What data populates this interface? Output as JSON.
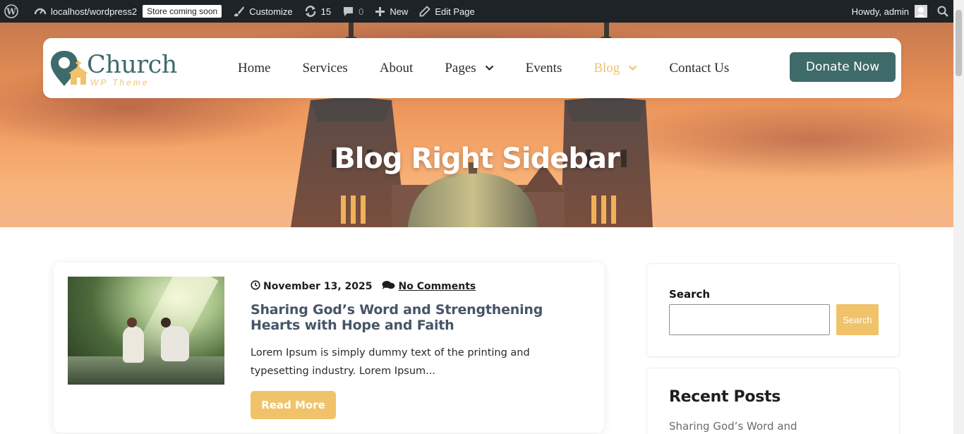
{
  "adminbar": {
    "site": "localhost/wordpress2",
    "badge": "Store coming soon",
    "customize": "Customize",
    "updates": "15",
    "comments": "0",
    "new": "New",
    "edit": "Edit Page",
    "howdy": "Howdy, admin"
  },
  "header": {
    "logo_word": "Church",
    "logo_sub": "WP Theme",
    "nav": [
      {
        "label": "Home"
      },
      {
        "label": "Services"
      },
      {
        "label": "About"
      },
      {
        "label": "Pages"
      },
      {
        "label": "Events"
      },
      {
        "label": "Blog"
      },
      {
        "label": "Contact Us"
      }
    ],
    "donate": "Donate Now"
  },
  "hero": {
    "title": "Blog Right Sidebar"
  },
  "post": {
    "date": "November 13, 2025",
    "comments": "No Comments",
    "title": "Sharing God’s Word and Strengthening Hearts with Hope and Faith",
    "excerpt": "Lorem Ipsum is simply dummy text of the printing and typesetting industry. Lorem Ipsum...",
    "read_more": "Read More"
  },
  "sidebar": {
    "search_label": "Search",
    "search_button": "Search",
    "search_value": "",
    "recent_title": "Recent Posts",
    "recent_first": "Sharing God’s Word and"
  },
  "colors": {
    "accent": "#f0c36a",
    "brand": "#3f6a6a",
    "adminbar": "#1d2327"
  }
}
